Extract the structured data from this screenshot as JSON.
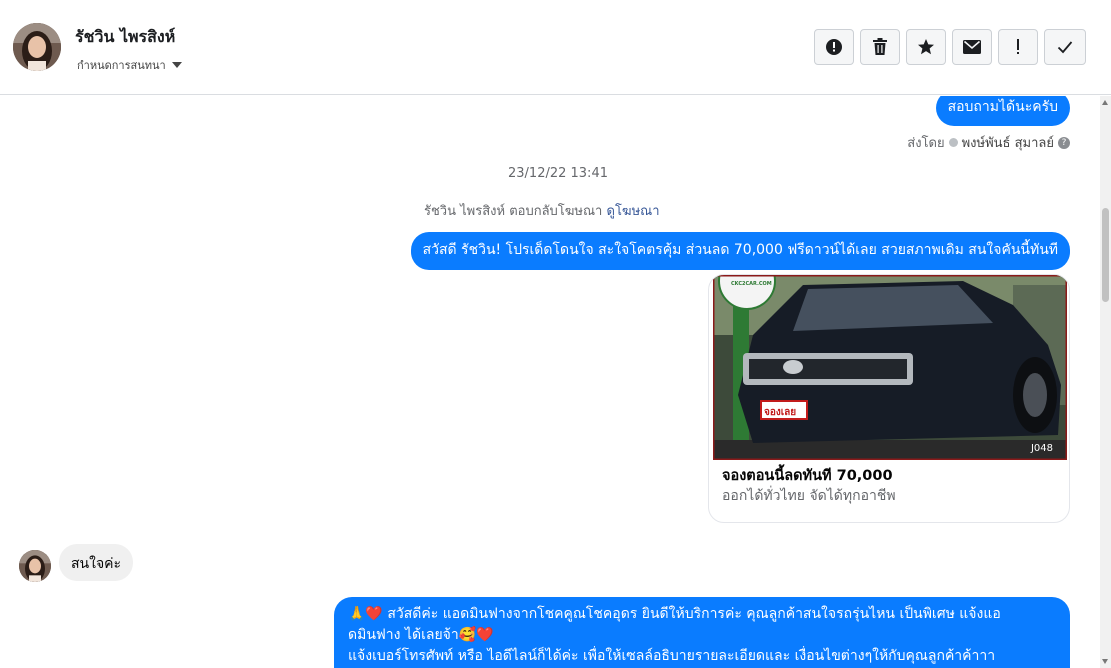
{
  "header": {
    "contact_name": "รัชวิน ไพรสิงห์",
    "assign_label": "กำหนดการสนทนา",
    "toolbar": [
      {
        "name": "report-button",
        "icon": "alert-circle-icon"
      },
      {
        "name": "delete-button",
        "icon": "trash-icon"
      },
      {
        "name": "star-button",
        "icon": "star-icon"
      },
      {
        "name": "mark-unread-button",
        "icon": "envelope-icon"
      },
      {
        "name": "important-button",
        "icon": "exclamation-icon"
      },
      {
        "name": "done-button",
        "icon": "checkmark-icon"
      }
    ]
  },
  "chat": {
    "msg1_text": "สอบถามได้นะครับ",
    "sent_by_label": "ส่งโดย",
    "sent_by_name": "พงษ์พันธ์ สุมาลย์",
    "timestamp": "23/12/22 13:41",
    "ad_reply_text": "รัชวิน ไพรสิงห์ ตอบกลับโฆษณา",
    "ad_link": "ดูโฆษณา",
    "msg2_text": "สวัสดี รัชวิน! โปรเด็ดโดนใจ สะใจโคตรคุ้ม ส่วนลด 70,000 ฟรีดาวน์ได้เลย สวยสภาพเดิม สนใจคันนี้ทันที",
    "card": {
      "image_stamp": "จองเลย",
      "image_code": "J048",
      "logo_text": "CKC2CAR.COM",
      "title": "จองตอนนี้ลดทันที 70,000",
      "subtitle": "ออกได้ทั่วไทย จัดได้ทุกอาชีพ"
    },
    "msg3_text": "สนใจค่ะ",
    "msg4_line1": "🙏❤️ สวัสดีค่ะ แอดมินฟางจากโชคคูณโชคอุดร ยินดีให้บริการค่ะ  คุณลูกค้าสนใจรถรุ่นไหน เป็นพิเศษ แจ้งแอ",
    "msg4_line2": "ดมินฟาง ได้เลยจ้า🥰❤️",
    "msg4_line3": "แจ้งเบอร์โทรศัพท์ หรือ ไอดีไลน์ก็ได้ค่ะ เพื่อให้เซลล์อธิบายรายละเอียดและ เงื่อนไขต่างๆให้กับคุณลูกค้าค้าาา"
  },
  "colors": {
    "bubble_out": "#0a7cff",
    "bubble_in": "#f0f0f0",
    "meta": "#65676b"
  }
}
